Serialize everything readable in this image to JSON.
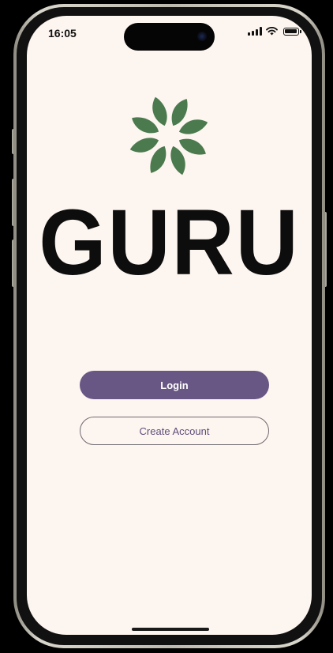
{
  "status_bar": {
    "time": "16:05",
    "icons": [
      "cellular-signal-icon",
      "wifi-icon",
      "battery-icon"
    ]
  },
  "logo": {
    "icon": "flower-logo-icon",
    "wordmark": "GURU",
    "leaf_color": "#4b7a4e"
  },
  "actions": {
    "login_label": "Login",
    "create_account_label": "Create Account"
  },
  "colors": {
    "background": "#fdf5ef",
    "primary": "#685784",
    "wordmark": "#0d0d0d"
  }
}
